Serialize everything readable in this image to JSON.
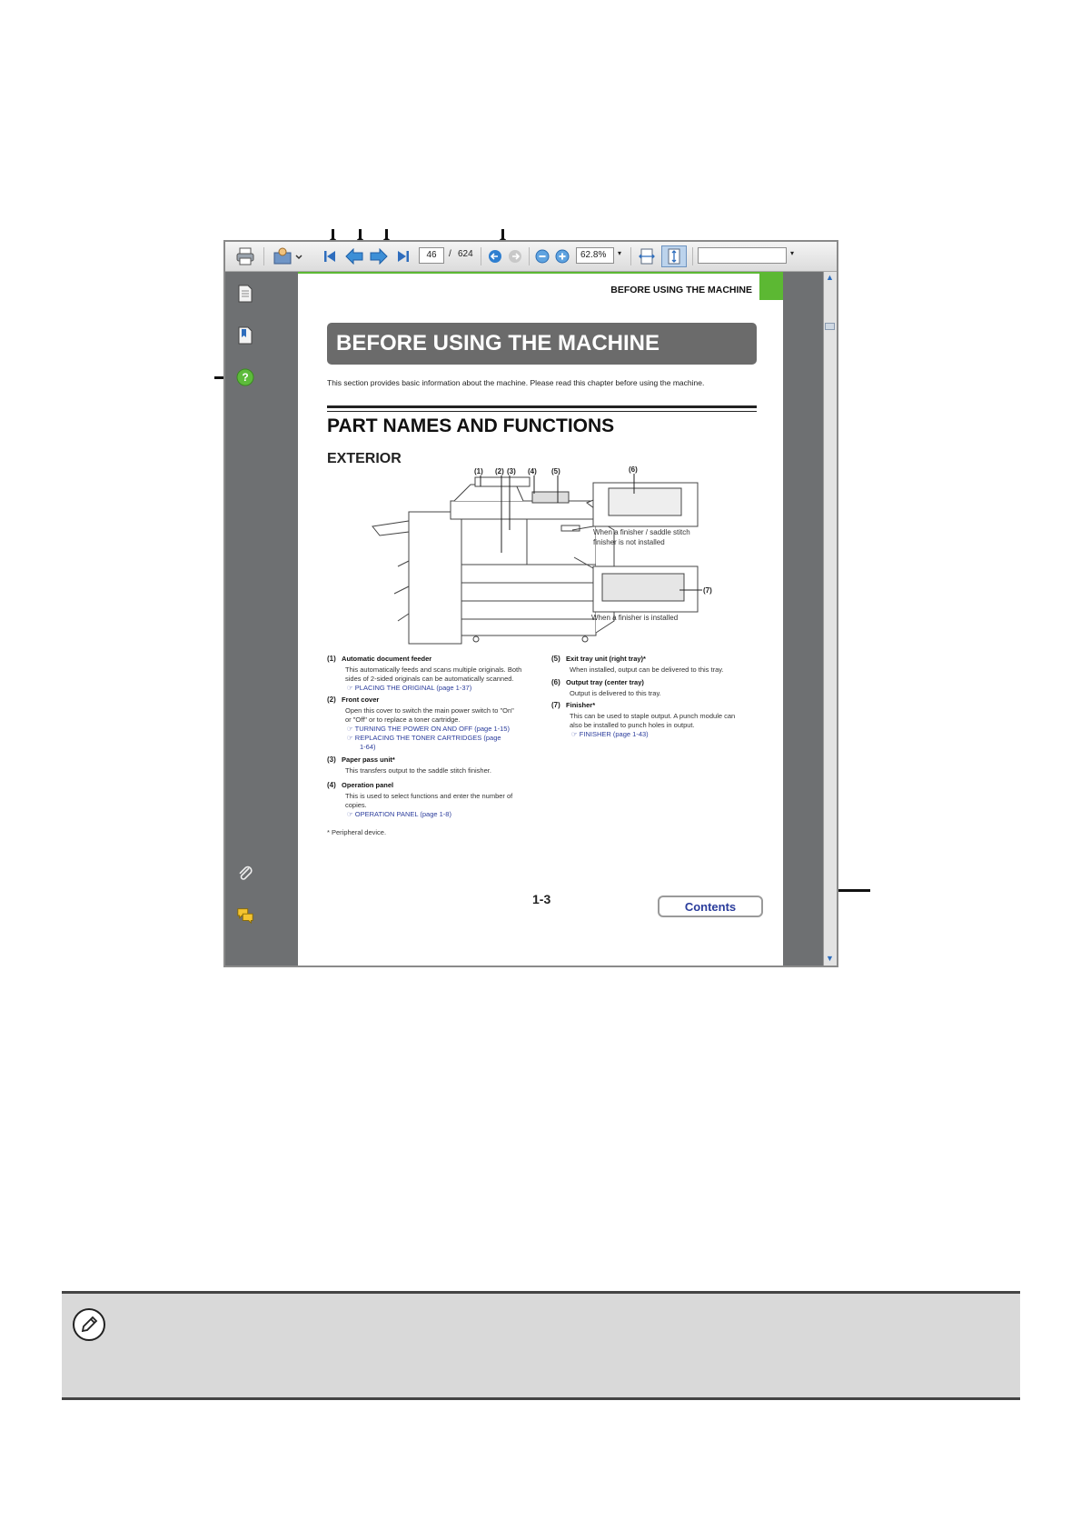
{
  "toolbar": {
    "page_current": "46",
    "page_sep": "/",
    "page_total": "624",
    "zoom": "62.8%"
  },
  "page": {
    "header_section": "BEFORE USING THE MACHINE",
    "title": "BEFORE USING THE MACHINE",
    "intro": "This section provides basic information about the machine. Please read this chapter before using the machine.",
    "h2": "PART NAMES AND FUNCTIONS",
    "h3": "EXTERIOR",
    "figure_labels": [
      "(1)",
      "(2)",
      "(3)",
      "(4)",
      "(5)",
      "(6)",
      "(7)"
    ],
    "caption_not_installed_1": "When a finisher / saddle stitch",
    "caption_not_installed_2": "finisher is not installed",
    "caption_installed": "When a finisher is installed",
    "items_left": [
      {
        "num": "(1)",
        "title": "Automatic document feeder",
        "text1": "This automatically feeds and scans multiple originals. Both",
        "text2": "sides of 2-sided originals can be automatically scanned.",
        "link": "☞ PLACING THE ORIGINAL (page 1-37)"
      },
      {
        "num": "(2)",
        "title": "Front cover",
        "text1": "Open this cover to switch the main power switch to \"On\"",
        "text2": "or \"Off\" or to replace a toner cartridge.",
        "link": "☞ TURNING THE POWER ON AND OFF (page 1-15)",
        "link2": "☞ REPLACING THE TONER CARTRIDGES (page",
        "link3": "1-64)"
      },
      {
        "num": "(3)",
        "title": "Paper pass unit*",
        "text1": "This transfers output to the saddle stitch finisher."
      },
      {
        "num": "(4)",
        "title": "Operation panel",
        "text1": "This is used to select functions and enter the number of",
        "text2": "copies.",
        "link": "☞ OPERATION PANEL (page 1-8)"
      }
    ],
    "items_right": [
      {
        "num": "(5)",
        "title": "Exit tray unit (right tray)*",
        "text1": "When installed, output can be delivered to this tray."
      },
      {
        "num": "(6)",
        "title": "Output tray (center tray)",
        "text1": "Output is delivered to this tray."
      },
      {
        "num": "(7)",
        "title": "Finisher*",
        "text1": "This can be used to staple output. A punch module can",
        "text2": "also be installed to punch holes in output.",
        "link": "☞ FINISHER (page 1-43)"
      }
    ],
    "footnote": "*  Peripheral device.",
    "page_number": "1-3",
    "contents_button": "Contents"
  }
}
